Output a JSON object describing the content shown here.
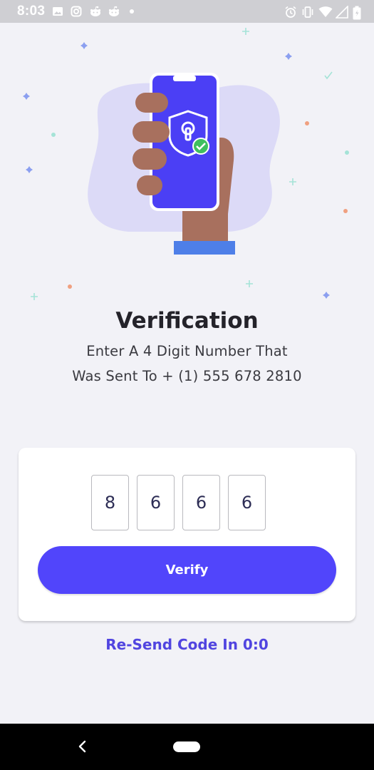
{
  "status_bar": {
    "time": "8:03",
    "left_icons": [
      "image-icon",
      "instagram-icon",
      "reddit-icon",
      "reddit-icon",
      "dot-icon"
    ],
    "right_icons": [
      "alarm-icon",
      "vibrate-icon",
      "wifi-icon",
      "signal-icon",
      "battery-icon"
    ]
  },
  "illustration": {
    "name": "phone-with-shield-lock",
    "colors": {
      "blob": "#dcdaf7",
      "phone": "#4b3ff5",
      "hand": "#a8705e",
      "check": "#3fbf5f",
      "sleeve": "#4e7fe8"
    }
  },
  "heading": {
    "title": "Verification",
    "line1": "Enter A 4 Digit Number That",
    "line2": "Was Sent To + (1) 555 678 2810"
  },
  "otp": {
    "digits": [
      "8",
      "6",
      "6",
      "6"
    ]
  },
  "verify": {
    "label": "Verify",
    "color": "#5145fb"
  },
  "resend": {
    "label": "Re-Send Code In 0:0",
    "color": "#5145e0"
  }
}
